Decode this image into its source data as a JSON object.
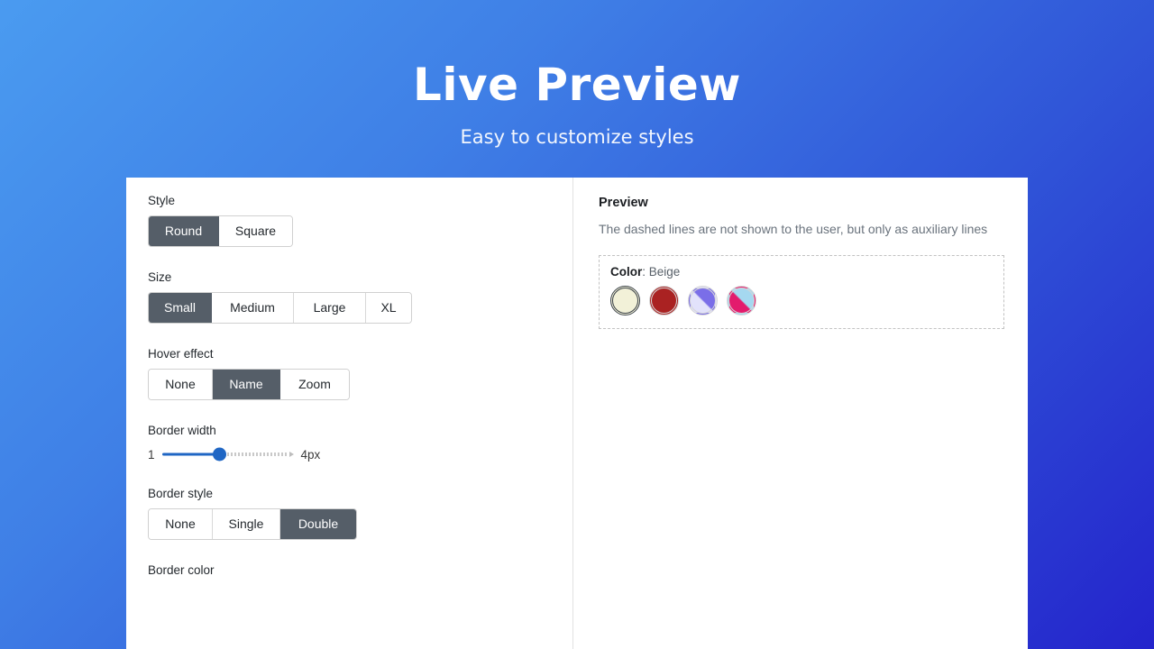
{
  "header": {
    "title": "Live Preview",
    "subtitle": "Easy to customize styles"
  },
  "controls": {
    "style": {
      "label": "Style",
      "options": [
        "Round",
        "Square"
      ],
      "selected": "Round"
    },
    "size": {
      "label": "Size",
      "options": [
        "Small",
        "Medium",
        "Large",
        "XL"
      ],
      "selected": "Small"
    },
    "hover_effect": {
      "label": "Hover effect",
      "options": [
        "None",
        "Name",
        "Zoom"
      ],
      "selected": "Name"
    },
    "border_width": {
      "label": "Border width",
      "min": "1",
      "max": "4px",
      "value": 2,
      "value_display": "4px"
    },
    "border_style": {
      "label": "Border style",
      "options": [
        "None",
        "Single",
        "Double"
      ],
      "selected": "Double"
    },
    "border_color": {
      "label": "Border color"
    }
  },
  "preview": {
    "title": "Preview",
    "note": "The dashed lines are not shown to the user, but only as auxiliary lines",
    "swatch_caption_label": "Color",
    "swatch_caption_value": ": Beige",
    "swatches": [
      {
        "name": "beige",
        "fill": "#f2f1d8",
        "border": "#3b424a"
      },
      {
        "name": "darkred",
        "fill": "#aa2222",
        "border": "#d6d6d6"
      },
      {
        "name": "slate",
        "fill": "#7a6ee8",
        "fill2": "#e2e2fb",
        "border": "#d6d6d6"
      },
      {
        "name": "pink",
        "fill": "#e31b6d",
        "fill2": "#a5d8f0",
        "border": "#d6d6d6"
      }
    ]
  },
  "theme": {
    "accent": "#1f66c4",
    "selected_segment": "#555e68",
    "bg_from": "#4a9bf0",
    "bg_to": "#2424cc"
  }
}
